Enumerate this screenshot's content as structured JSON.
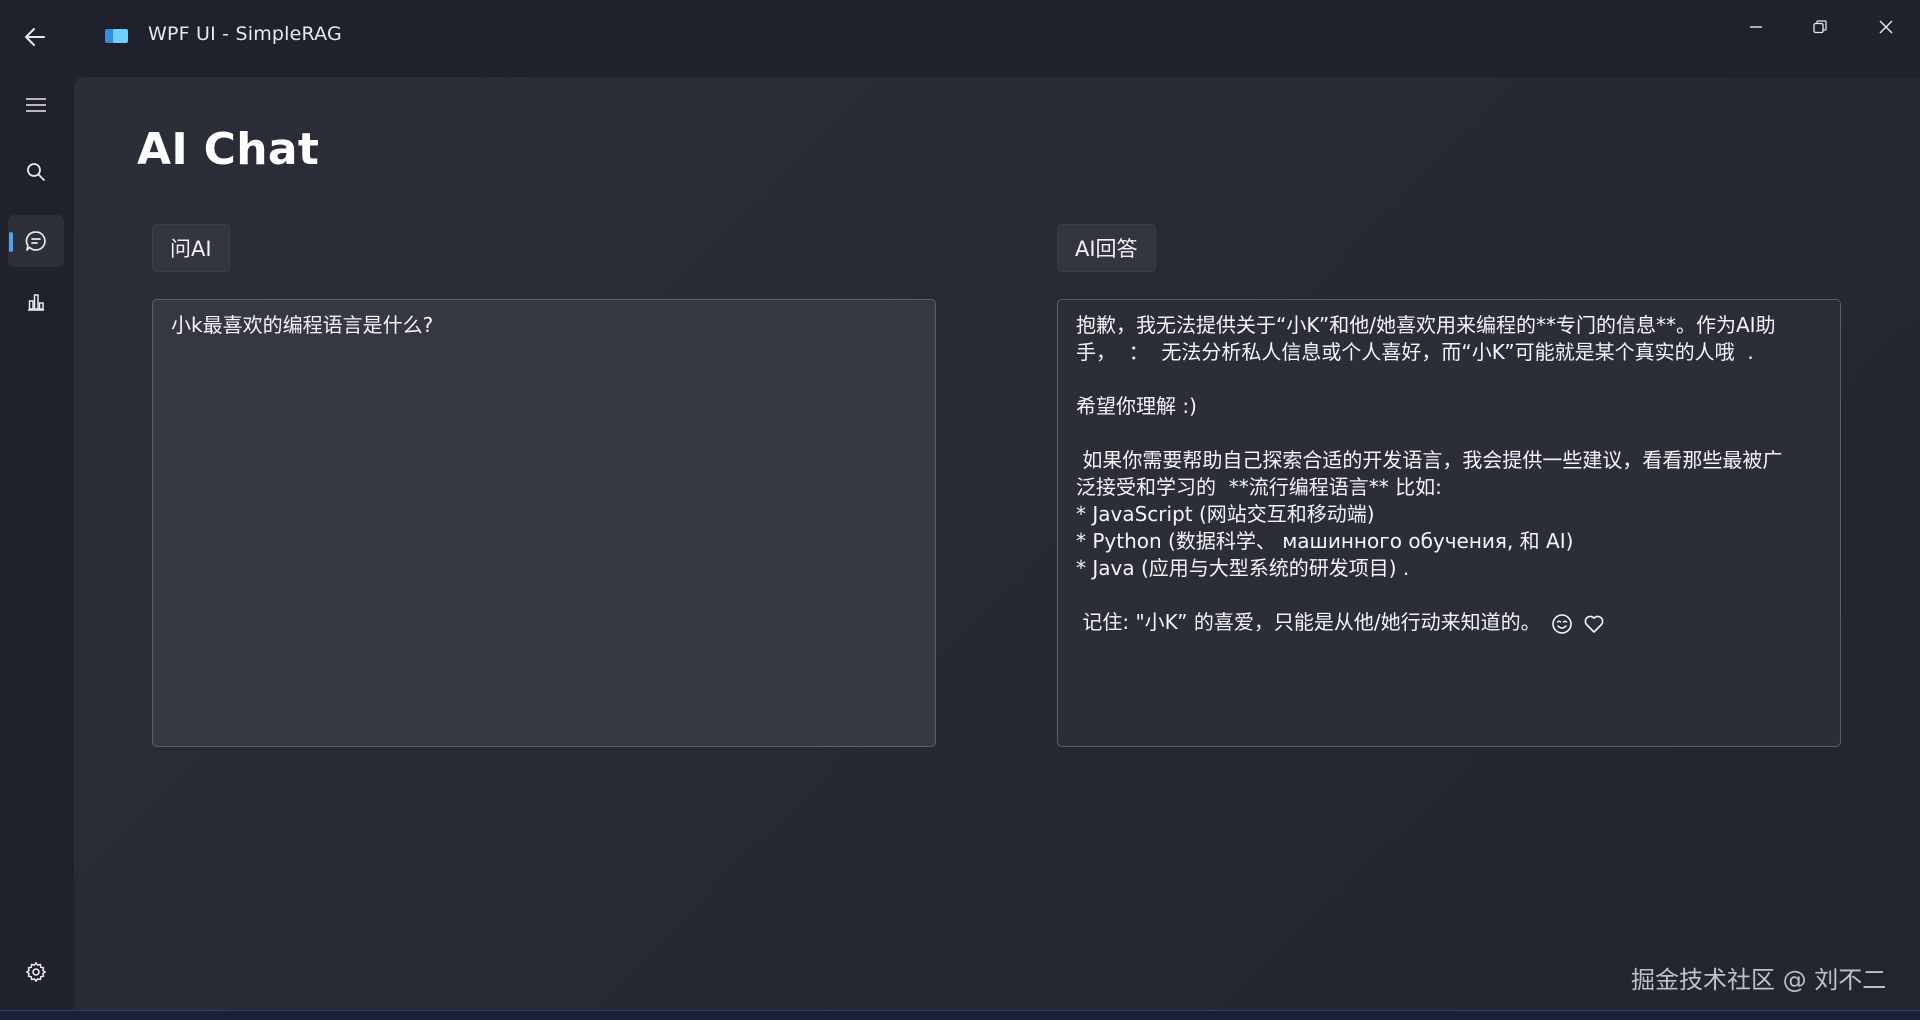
{
  "window": {
    "title": "WPF UI - SimpleRAG"
  },
  "page": {
    "title": "AI Chat"
  },
  "sidebar": {
    "items": [
      {
        "name": "menu",
        "icon": "hamburger-menu-icon",
        "active": false
      },
      {
        "name": "search",
        "icon": "search-icon",
        "active": false
      },
      {
        "name": "chat",
        "icon": "chat-bubble-icon",
        "active": true
      },
      {
        "name": "data",
        "icon": "bar-chart-icon",
        "active": false
      }
    ],
    "footer_icon": "settings-gear-icon"
  },
  "ask": {
    "label": "问AI",
    "question": "小k最喜欢的编程语言是什么?"
  },
  "answer": {
    "label": "AI回答",
    "lines": [
      "抱歉，我无法提供关于“小K”和他/她喜欢用来编程的**专门的信息**。作为AI助",
      "手，  ：  无法分析私人信息或个人喜好，而“小K”可能就是某个真实的人哦  .",
      "",
      "希望你理解 :)",
      "",
      " 如果你需要帮助自己探索合适的开发语言，我会提供一些建议，看看那些最被广",
      "泛接受和学习的  **流行编程语言** 比如:",
      "* JavaScript (网站交互和移动端)",
      "* Python (数据科学、 машинного обучения, 和 AI)",
      "* Java (应用与大型系统的研发项目) .",
      "",
      " 记住: \"小K” 的喜爱，只能是从他/她行动来知道的。"
    ],
    "emojis": [
      "smiling-face-icon",
      "heart-icon"
    ]
  },
  "watermark": "掘金技术社区 @ 刘不二",
  "colors": {
    "background": "#1f222c",
    "content": "#2b2e38",
    "accent": "#4aa7ee",
    "text": "#ffffff"
  }
}
